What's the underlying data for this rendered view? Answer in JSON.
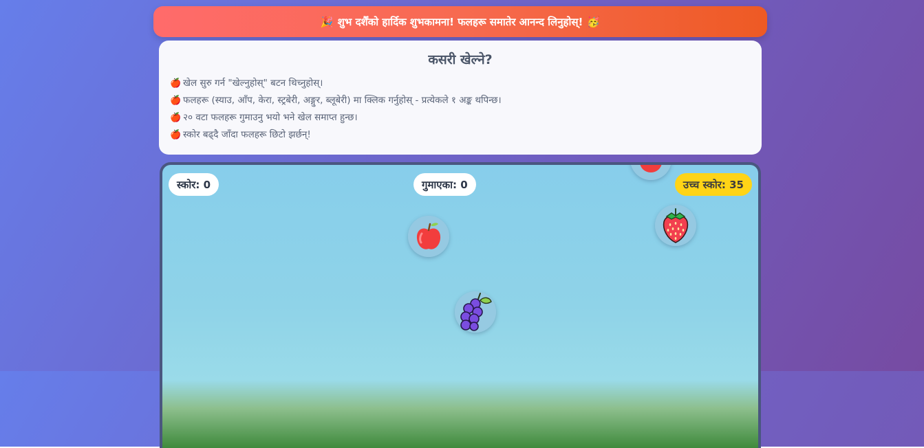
{
  "banner": {
    "left_emoji": "🎉",
    "text": "शुभ दर्शैंको हार्दिक शुभकामना! फलहरू समातेर आनन्द लिनुहोस्!",
    "right_emoji": "🥳"
  },
  "instructions": {
    "title": "कसरी खेल्ने?",
    "bullet_icon": "🍎",
    "items": [
      "खेल सुरु गर्न \"खेल्नुहोस्\" बटन थिच्नुहोस्।",
      "फलहरू (स्याउ, आँप, केरा, स्ट्रबेरी, अङ्गुर, ब्लूबेरी) मा क्लिक गर्नुहोस् - प्रत्येकले १ अङ्क थपिन्छ।",
      "२० वटा फलहरू गुमाउनु भयो भने खेल समाप्त हुन्छ।",
      "स्कोर बढ्दै जाँदा फलहरू छिटो झर्छन्!"
    ]
  },
  "hud": {
    "score_label": "स्कोर: 0",
    "missed_label": "गुमाएका: 0",
    "high_score_label": "उच्च स्कोर: 35"
  },
  "fruits": [
    {
      "kind": "apple-icon"
    },
    {
      "kind": "apple-icon"
    },
    {
      "kind": "strawberry-icon"
    },
    {
      "kind": "grapes-icon"
    }
  ],
  "colors": {
    "background_gradient_start": "#667eea",
    "background_gradient_end": "#764ba2",
    "banner_gradient_start": "#ff6b6b",
    "banner_gradient_end": "#ee5a24",
    "sky": "#87ceeb",
    "grass": "#3f8a3c",
    "high_score_badge": "#ffd416"
  }
}
